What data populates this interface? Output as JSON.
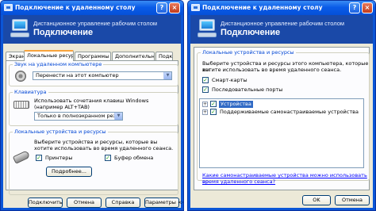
{
  "colors": {
    "title_blue": "#0a5ce8",
    "banner_blue": "#1a49a8",
    "face": "#ece9d8",
    "tab_accent": "#f9a43c",
    "link": "#0000ff",
    "selection": "#316ac5"
  },
  "icons": {
    "app": "computer-icon",
    "close": "close-icon",
    "help": "help-icon",
    "speaker": "speaker-icon",
    "keyboard": "keyboard-icon",
    "plug": "plug-icon"
  },
  "left": {
    "title": "Подключение к удаленному столу",
    "banner_line1": "Дистанционное управление рабочим столом",
    "banner_line2": "Подключение",
    "tabs": [
      "Экран",
      "Локальные ресурсы",
      "Программы",
      "Дополнительно",
      "Подк"
    ],
    "sound": {
      "legend": "Звук на удаленном компьютере",
      "value": "Перенести на этот компьютер"
    },
    "keyboard": {
      "legend": "Клавиатура",
      "text_line1": "Использовать сочетания клавиш Windows",
      "text_line2": "(например ALT+TAB)",
      "value": "Только в полноэкранном режиме"
    },
    "local": {
      "legend": "Локальные устройства и ресурсы",
      "text_line1": "Выберите устройства и ресурсы, которые вы",
      "text_line2": "хотите использовать во время удаленного сеанса.",
      "printers": "Принтеры",
      "clipboard": "Буфер обмена",
      "more_button": "Подробнее..."
    },
    "buttons": {
      "connect": "Подключить",
      "cancel": "Отмена",
      "help": "Справка",
      "options": "Параметры <<"
    }
  },
  "right": {
    "title": "Подключение к удаленному столу",
    "banner_line1": "Дистанционное управление рабочим столом",
    "banner_line2": "Подключение",
    "legend": "Локальные устройства и ресурсы",
    "text_line1": "Выберите устройства и ресурсы этого компьютера, которые вы",
    "text_line2": "хотите использовать во время удаленного сеанса.",
    "smartcards": "Смарт-карты",
    "serial": "Последовательные порты",
    "tree": {
      "devices": "Устройства",
      "pnp": "Поддерживаемые самонастраиваемые устройства"
    },
    "link_line1": "Какие самонастраиваемые устройства можно использовать во",
    "link_line2": "время удаленного сеанса?",
    "buttons": {
      "ok": "OK",
      "cancel": "Отмена"
    }
  }
}
